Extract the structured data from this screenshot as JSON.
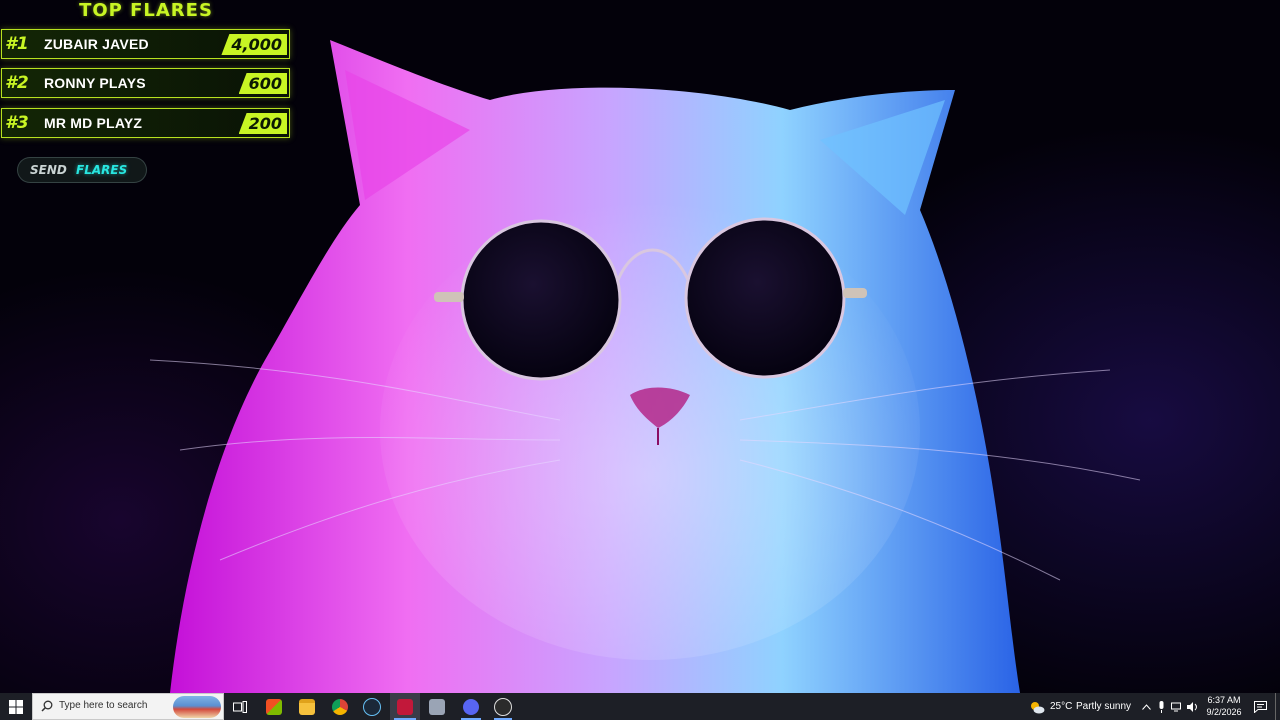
{
  "overlay": {
    "title": "TOP FLARES",
    "leaderboard": [
      {
        "rank": "#1",
        "name": "ZUBAIR JAVED",
        "amount": "4,000"
      },
      {
        "rank": "#2",
        "name": "RONNY PLAYS",
        "amount": "600"
      },
      {
        "rank": "#3",
        "name": "MR MD PLAYZ",
        "amount": "200"
      }
    ],
    "send_button": {
      "word1": "SEND",
      "word2": "FLARES"
    }
  },
  "taskbar": {
    "search_placeholder": "Type here to search",
    "apps": [
      "task-view",
      "microsoft-store",
      "file-explorer",
      "chrome",
      "steam",
      "app-red",
      "app-photos",
      "discord",
      "obs"
    ],
    "weather": {
      "temp": "25°C",
      "condition": "Partly sunny"
    },
    "clock": {
      "time": "6:37 AM",
      "date": "9/2/2026"
    }
  },
  "colors": {
    "accent_lime": "#c8f524",
    "accent_cyan": "#28e6e0",
    "taskbar_bg": "#1d1f26"
  }
}
